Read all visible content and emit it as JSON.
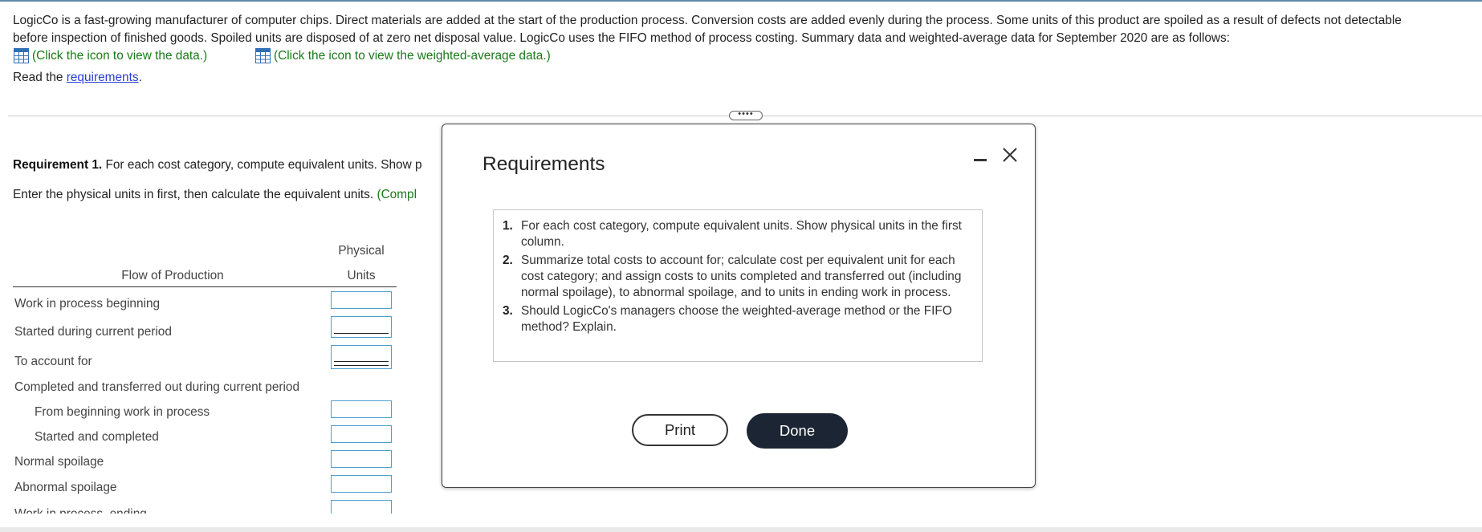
{
  "intro": {
    "line1": "LogicCo is a fast-growing manufacturer of computer chips. Direct materials are added at the start of the production process. Conversion costs are added evenly during the process. Some units of this product are spoiled as a result of defects not detectable",
    "line2": "before inspection of finished goods. Spoiled units are disposed of at zero net disposal value. LogicCo uses the FIFO method of process costing. Summary data and weighted-average data for September 2020 are as follows:",
    "data_link": "(Click the icon to view the data.)",
    "wa_link": "(Click the icon to view the weighted-average data.)",
    "read_prefix": "Read the ",
    "requirements_link": "requirements",
    "read_suffix": "."
  },
  "expander": "••••",
  "worksheet": {
    "req1_bold": "Requirement 1.",
    "req1_text": " For each cost category, compute equivalent units. Show p",
    "enter_text": "Enter the physical units in first, then calculate the equivalent units. ",
    "enter_green": "(Compl",
    "col_physical": "Physical",
    "col_units": "Units",
    "col_flow": "Flow of Production",
    "rows": [
      "Work in process beginning",
      "Started during current period",
      "To account for",
      "Completed and transferred out during current period",
      "From beginning work in process",
      "Started and completed",
      "Normal spoilage",
      "Abnormal spoilage",
      "Work in process, ending"
    ]
  },
  "modal": {
    "title": "Requirements",
    "items": [
      {
        "num": "1.",
        "text": "For each cost category, compute equivalent units. Show physical units in the first column."
      },
      {
        "num": "2.",
        "text": "Summarize total costs to account for; calculate cost per equivalent unit for each cost category; and assign costs to units completed and transferred out (including normal spoilage), to abnormal spoilage, and to units in ending work in process."
      },
      {
        "num": "3.",
        "text": "Should LogicCo's managers choose the weighted-average method or the FIFO method? Explain."
      }
    ],
    "print_label": "Print",
    "done_label": "Done"
  },
  "colors": {
    "link_green": "#1a7a1a",
    "link_blue": "#2a3fd6",
    "input_border": "#4a9fd0",
    "done_bg": "#1c2533"
  }
}
